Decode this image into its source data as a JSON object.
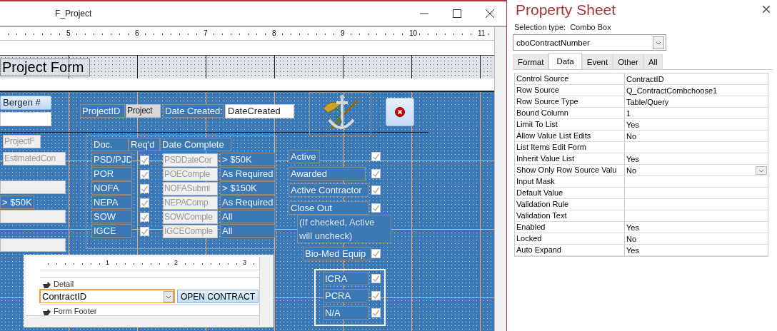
{
  "window": {
    "title": "F_Project"
  },
  "ruler": {
    "marks": [
      "5",
      "6",
      "7",
      "8",
      "9",
      "10",
      "11"
    ]
  },
  "form_header": {
    "title_label": "Project Form"
  },
  "detail": {
    "bergen_label": "Bergen #",
    "project_id": {
      "label": "ProjectID",
      "field": "Project"
    },
    "date_created": {
      "label": "Date Created:",
      "field": "DateCreated"
    },
    "left_items": [
      {
        "kind": "field",
        "text": "ProjectF"
      },
      {
        "kind": "field",
        "text": "EstimatedCon"
      },
      {
        "kind": "field"
      },
      {
        "kind": "label",
        "text": "> $50K"
      },
      {
        "kind": "field"
      },
      {
        "kind": "field"
      }
    ],
    "docs": {
      "columns": [
        "Doc.",
        "Req'd",
        "Date Complete"
      ],
      "rows": [
        {
          "doc": "PSD/PJD",
          "checked": true,
          "date_field": "PSDDateCor",
          "threshold": "> $50K"
        },
        {
          "doc": "POR",
          "checked": true,
          "date_field": "POEComple",
          "threshold": "As Required"
        },
        {
          "doc": "NOFA",
          "checked": true,
          "date_field": "NOFASubmi",
          "threshold": "> $150K"
        },
        {
          "doc": "NEPA",
          "checked": true,
          "date_field": "NEPAComp",
          "threshold": "As Required"
        },
        {
          "doc": "SOW",
          "checked": true,
          "date_field": "SOWComple",
          "threshold": "All"
        },
        {
          "doc": "IGCE",
          "checked": true,
          "date_field": "IGCEComple",
          "threshold": "All"
        }
      ]
    },
    "status_checks": [
      {
        "label": "Active",
        "checked": true
      },
      {
        "label": "Awarded",
        "checked": true
      },
      {
        "label": "Active Contractor",
        "checked": true
      },
      {
        "label": "Close Out",
        "checked": true
      }
    ],
    "close_out_note": "(If checked, Active will uncheck)",
    "bio_med": {
      "label": "Bio-Med Equip",
      "checked": true
    },
    "review_group": [
      {
        "label": "ICRA",
        "checked": true
      },
      {
        "label": "PCRA",
        "checked": true
      },
      {
        "label": "N/A",
        "checked": true
      }
    ],
    "subform": {
      "ruler_marks": [
        "1",
        "2",
        "3"
      ],
      "sections": [
        "Detail",
        "Form Footer"
      ],
      "combo": "ContractID",
      "button": "OPEN CONTRACT"
    }
  },
  "property_sheet": {
    "title": "Property Sheet",
    "selection_type_label": "Selection type:",
    "selection_type": "Combo Box",
    "control": "cboContractNumber",
    "tabs": [
      {
        "label": "Format",
        "selected": false
      },
      {
        "label": "Data",
        "selected": true
      },
      {
        "label": "Event",
        "selected": false
      },
      {
        "label": "Other",
        "selected": false
      },
      {
        "label": "All",
        "selected": false
      }
    ],
    "properties": [
      {
        "name": "Control Source",
        "value": "ContractID",
        "dropdown": false
      },
      {
        "name": "Row Source",
        "value": "Q_ContractCombchoose1",
        "dropdown": false
      },
      {
        "name": "Row Source Type",
        "value": "Table/Query",
        "dropdown": false
      },
      {
        "name": "Bound Column",
        "value": "1",
        "dropdown": false
      },
      {
        "name": "Limit To List",
        "value": "Yes",
        "dropdown": false
      },
      {
        "name": "Allow Value List Edits",
        "value": "No",
        "dropdown": false
      },
      {
        "name": "List Items Edit Form",
        "dropdown": false
      },
      {
        "name": "Inherit Value List",
        "value": "Yes",
        "dropdown": false
      },
      {
        "name": "Show Only Row Source Valu",
        "value": "No",
        "dropdown": true
      },
      {
        "name": "Input Mask",
        "dropdown": false
      },
      {
        "name": "Default Value",
        "dropdown": false
      },
      {
        "name": "Validation Rule",
        "dropdown": false
      },
      {
        "name": "Validation Text",
        "dropdown": false
      },
      {
        "name": "Enabled",
        "value": "Yes",
        "dropdown": false
      },
      {
        "name": "Locked",
        "value": "No",
        "dropdown": false
      },
      {
        "name": "Auto Expand",
        "value": "Yes",
        "dropdown": false
      }
    ]
  }
}
